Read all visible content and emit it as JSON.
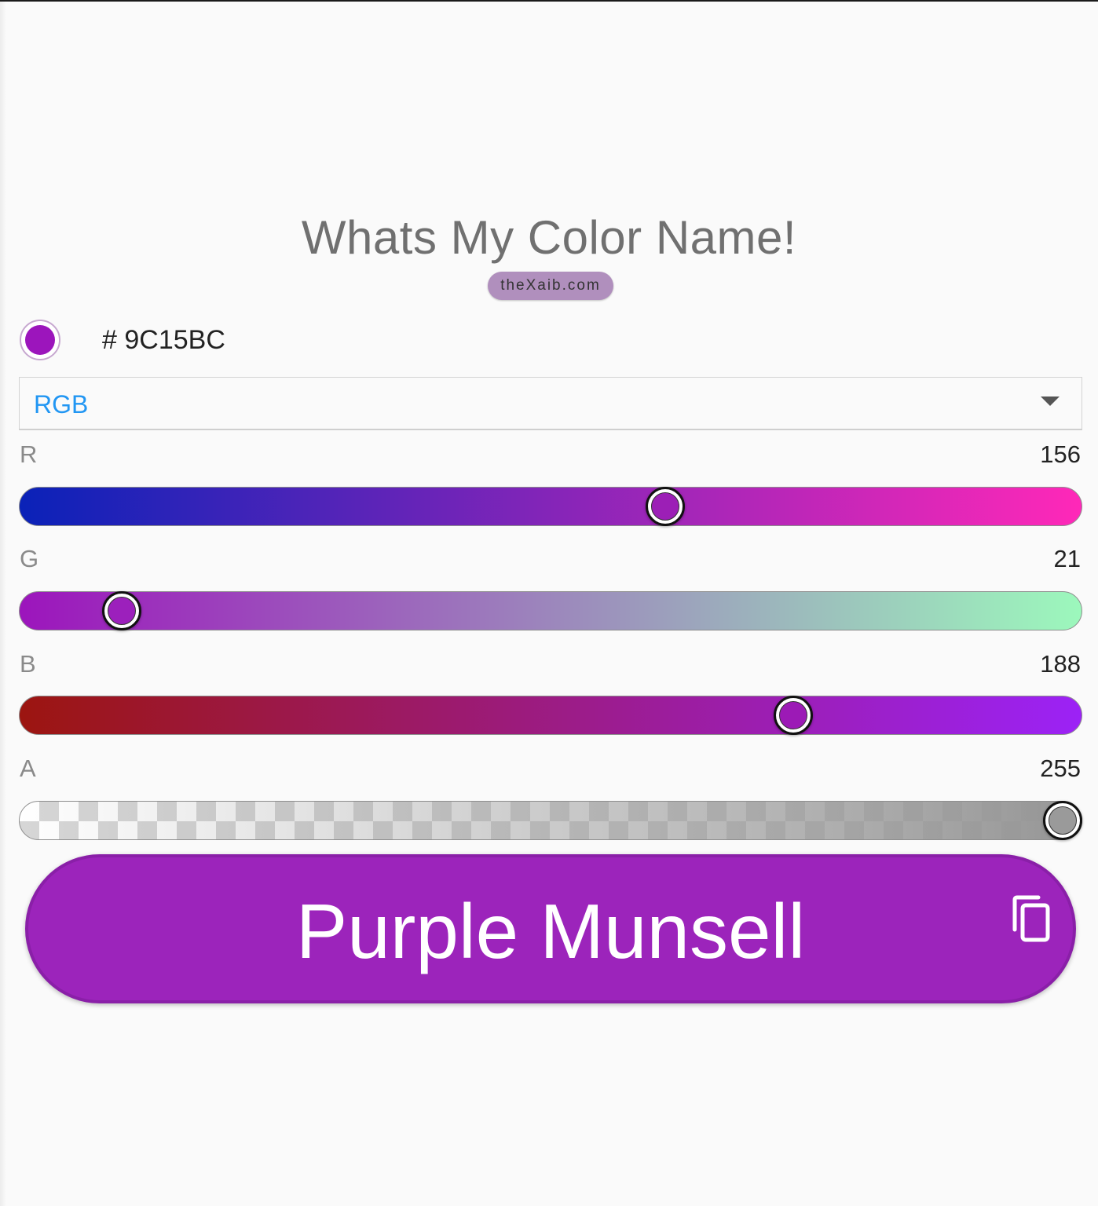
{
  "header": {
    "title": "Whats My Color Name!",
    "site": "theXaib.com"
  },
  "color": {
    "hex_label": "# 9C15BC",
    "swatch_color": "#9C15BC"
  },
  "mode_select": {
    "value": "RGB",
    "accent": "#2196F3"
  },
  "channels": [
    {
      "label": "R",
      "value": "156",
      "fraction": 0.612,
      "gradient": [
        "#0a22b8",
        "#ff28b8"
      ],
      "thumb_color": "#9c1fb6"
    },
    {
      "label": "G",
      "value": "21",
      "fraction": 0.082,
      "gradient": [
        "#9c15bc",
        "#9cf8bc"
      ],
      "thumb_color": "#9c20bc"
    },
    {
      "label": "B",
      "value": "188",
      "fraction": 0.737,
      "gradient": [
        "#9c1510",
        "#9c22f6"
      ],
      "thumb_color": "#9c1ab6"
    },
    {
      "label": "A",
      "value": "255",
      "fraction": 1.0,
      "gradient": [
        "rgba(150,150,150,0)",
        "rgba(150,150,150,1)"
      ],
      "thumb_color": "#9a9a9a"
    }
  ],
  "result": {
    "color_name": "Purple Munsell",
    "copy_icon": "copy-icon",
    "button_color": "#9C24BB"
  }
}
